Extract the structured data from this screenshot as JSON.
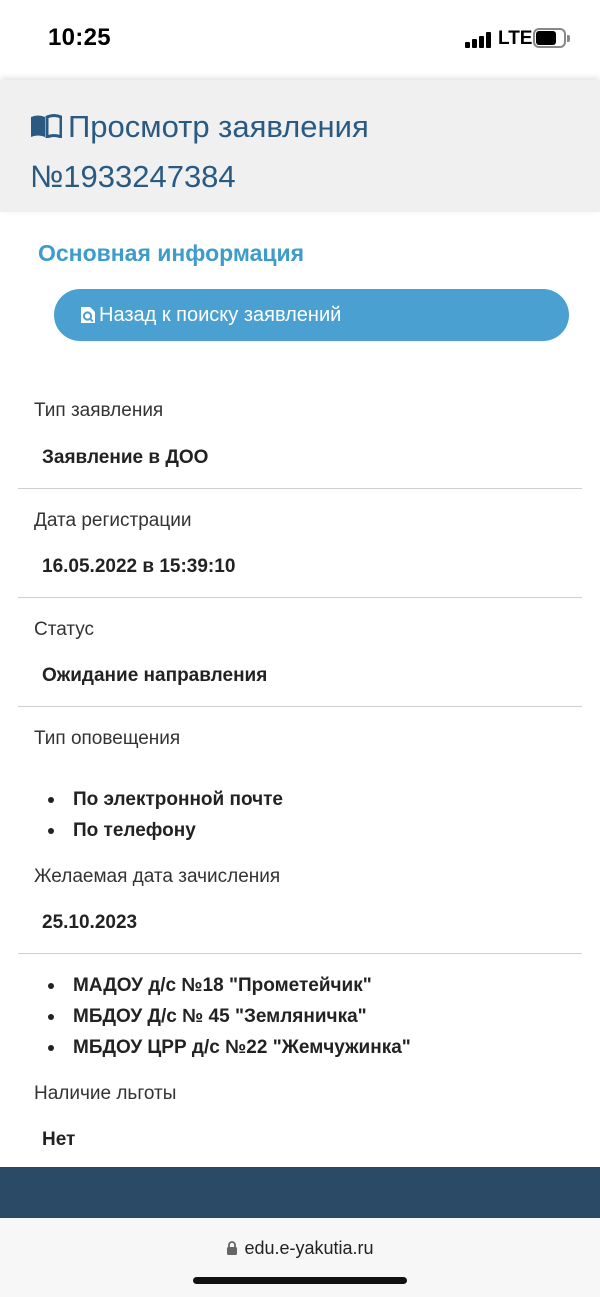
{
  "status_bar": {
    "time": "10:25",
    "network": "LTE"
  },
  "header": {
    "title_line1": "Просмотр заявления",
    "title_line2": "№1933247384"
  },
  "section_title": "Основная информация",
  "back_button": {
    "label": "Назад к поиску заявлений"
  },
  "fields": {
    "type": {
      "label": "Тип заявления",
      "value": "Заявление в ДОО"
    },
    "registration_date": {
      "label": "Дата регистрации",
      "value": "16.05.2022 в 15:39:10"
    },
    "status": {
      "label": "Статус",
      "value": "Ожидание направления"
    },
    "notification_type": {
      "label": "Тип оповещения",
      "items": [
        "По электронной почте",
        "По телефону"
      ]
    },
    "desired_date": {
      "label": "Желаемая дата зачисления",
      "value": "25.10.2023"
    },
    "institutions": {
      "items": [
        "МАДОУ д/с №18 \"Прометейчик\"",
        "МБДОУ Д/с № 45 \"Земляничка\"",
        "МБДОУ ЦРР д/с №22 \"Жемчужинка\""
      ]
    },
    "benefit": {
      "label": "Наличие льготы",
      "value": "Нет"
    }
  },
  "browser": {
    "url": "edu.e-yakutia.ru"
  },
  "colors": {
    "title": "#2a5a82",
    "section": "#3d9cc9",
    "button": "#4aa0d0",
    "footer": "#2b4a66"
  }
}
